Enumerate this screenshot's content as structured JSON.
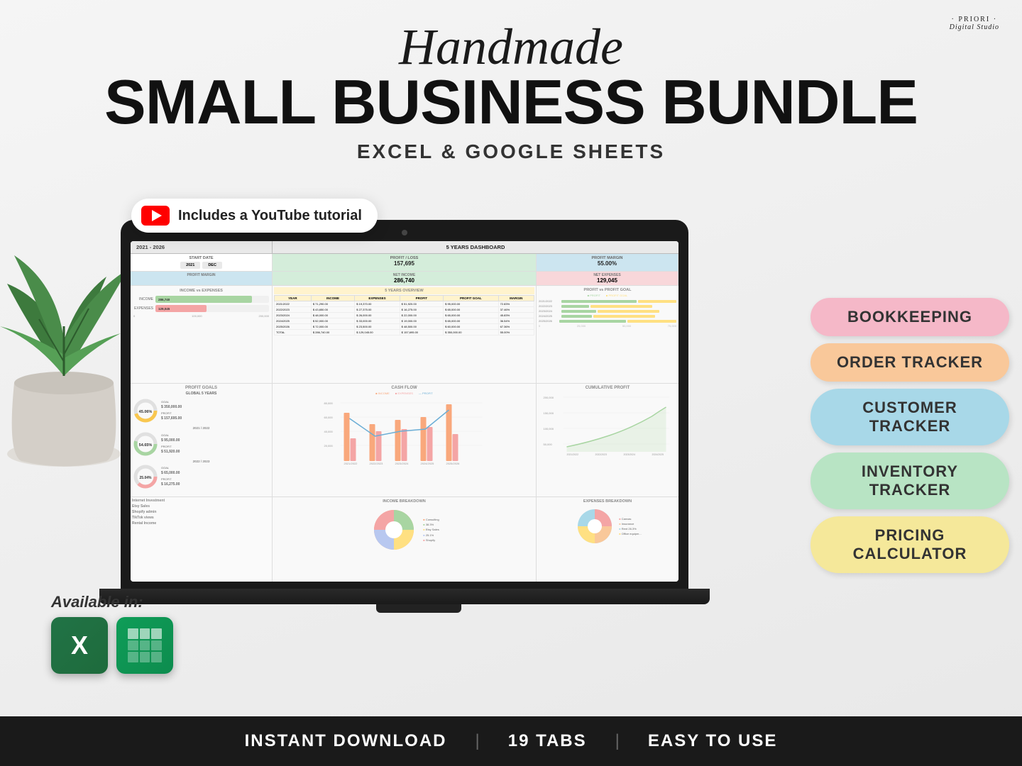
{
  "brand": {
    "name": "PRIORI",
    "subtitle": "Digital Studio",
    "dots_before": "·",
    "dots_after": "·"
  },
  "header": {
    "handmade": "Handmade",
    "main_title": "SMALL BUSINESS BUNDLE",
    "subtitle": "EXCEL & GOOGLE SHEETS"
  },
  "youtube_badge": {
    "text": "Includes a YouTube tutorial"
  },
  "spreadsheet": {
    "tab_left": "2021 - 2026",
    "tab_main": "5 YEARS DASHBOARD",
    "start_date_label": "START DATE",
    "start_year": "2021",
    "start_month": "DEC",
    "profit_loss_label": "PROFIT / LOSS",
    "profit_loss_value": "157,695",
    "profit_margin_label": "PROFIT MARGIN",
    "profit_margin_value": "55.00%",
    "profit_margin_label2": "PROFIT MARGIN",
    "net_income_label": "NET INCOME",
    "net_income_value": "286,740",
    "net_expenses_label": "NET EXPENSES",
    "net_expenses_value": "129,045",
    "income_vs_expenses_title": "INCOME vs EXPENSES",
    "income_label": "INCOME",
    "income_bar_value": "286,740",
    "expenses_label": "EXPENSES",
    "expenses_bar_value": "129,045",
    "five_years_title": "5 YEARS OVERVIEW",
    "table_headers": [
      "YEAR",
      "INCOME",
      "EXPENSES",
      "PROFIT",
      "PROFIT GOAL",
      "MARGIN"
    ],
    "table_rows": [
      [
        "2021/2022",
        "$ 71,290.00",
        "$ 19,370.00",
        "$ 51,920.00",
        "$ 95,000.00",
        "72.83%"
      ],
      [
        "2022/2023",
        "$ 43,650.00",
        "$ 27,375.00",
        "$ 16,275.00",
        "$ 65,000.00",
        "37.46%"
      ],
      [
        "2023/2024",
        "$ 48,000.00",
        "$ 26,000.00",
        "$ 22,000.00",
        "$ 65,000.00",
        "45.83%"
      ],
      [
        "2024/2025",
        "$ 52,000.00",
        "$ 33,000.00",
        "$ 19,000.00",
        "$ 65,000.00",
        "36.54%"
      ],
      [
        "2025/2026",
        "$ 72,000.00",
        "$ 23,500.00",
        "$ 48,500.00",
        "$ 60,000.00",
        "67.36%"
      ]
    ],
    "table_total": [
      "TOTAL",
      "$ 286,740.00",
      "$ 129,045.00",
      "$ 157,695.00",
      "$ 350,000.00",
      "55.00%"
    ],
    "profit_goals_title": "PROFIT GOALS",
    "global_5yr": "GLOBAL 5 YEARS",
    "goal_45": "45.06%",
    "goal_54": "54.65%",
    "goal_label": "GOAL",
    "goal_global": "$ 350,000.00",
    "profit_global": "$ 157,695.00",
    "year_2122": "2021 / 2022",
    "goal_2122": "$ 95,000.00",
    "profit_2122": "$ 51,920.00",
    "year_2223": "2022 / 2023",
    "goal_2223": "$ 65,000.00",
    "profit_2223": "$ 16,275.00",
    "cash_flow_title": "CASH FLOW",
    "cash_flow_legend_income": "INCOME",
    "cash_flow_legend_expenses": "EXPENSES",
    "cash_flow_legend_profit": "PROFIT",
    "cumulative_profit_title": "CUMULATIVE PROFIT",
    "profit_vs_goal_title": "PROFIT vs PROFIT GOAL",
    "income_breakdown_title": "INCOME BREAKDOWN",
    "expenses_breakdown_title": "EXPENSES BREAKDOWN"
  },
  "features": [
    {
      "label": "BOOKKEEPING",
      "color": "#f5b8c8"
    },
    {
      "label": "ORDER TRACKER",
      "color": "#f9c89a"
    },
    {
      "label": "CUSTOMER TRACKER",
      "color": "#a8d8e8"
    },
    {
      "label": "INVENTORY TRACKER",
      "color": "#b8e4c4"
    },
    {
      "label": "PRICING CALCULATOR",
      "color": "#f5e89a"
    }
  ],
  "available_in": {
    "label": "Available in:"
  },
  "bottom_bar": {
    "item1": "INSTANT DOWNLOAD",
    "sep1": "|",
    "item2": "19 TABS",
    "sep2": "|",
    "item3": "EASY TO USE"
  }
}
